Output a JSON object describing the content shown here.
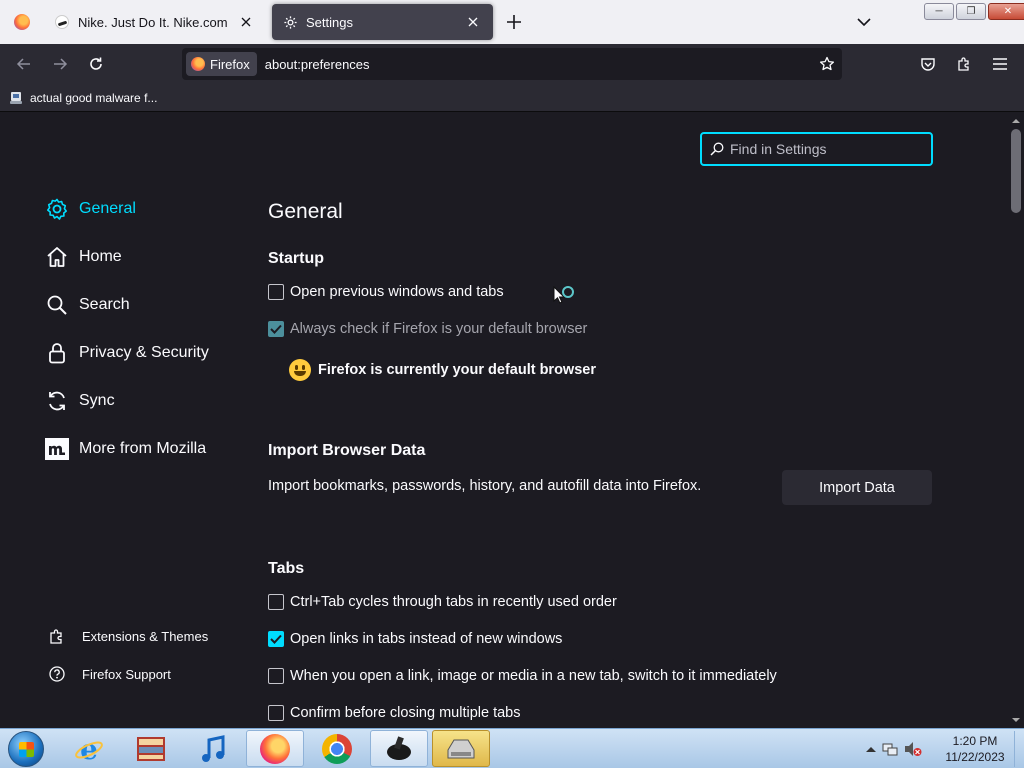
{
  "tabs": [
    {
      "title": "Nike. Just Do It. Nike.com",
      "icon": "nike-icon",
      "active": false
    },
    {
      "title": "Settings",
      "icon": "gear-icon",
      "active": true
    }
  ],
  "toolbar": {
    "identity_label": "Firefox",
    "url": "about:preferences"
  },
  "bookmarks": [
    {
      "label": "actual good malware f...",
      "icon": "bookmark-page-icon"
    }
  ],
  "search": {
    "placeholder": "Find in Settings"
  },
  "sidebar": {
    "categories": [
      {
        "label": "General",
        "icon": "gear-icon",
        "selected": true
      },
      {
        "label": "Home",
        "icon": "home-icon",
        "selected": false
      },
      {
        "label": "Search",
        "icon": "search-icon",
        "selected": false
      },
      {
        "label": "Privacy & Security",
        "icon": "lock-icon",
        "selected": false
      },
      {
        "label": "Sync",
        "icon": "sync-icon",
        "selected": false
      },
      {
        "label": "More from Mozilla",
        "icon": "mozilla-icon",
        "selected": false
      }
    ],
    "footer": [
      {
        "label": "Extensions & Themes",
        "icon": "puzzle-icon"
      },
      {
        "label": "Firefox Support",
        "icon": "help-icon"
      }
    ]
  },
  "main": {
    "title": "General",
    "startup": {
      "heading": "Startup",
      "open_previous": {
        "label": "Open previous windows and tabs",
        "checked": false
      },
      "check_default": {
        "label": "Always check if Firefox is your default browser",
        "checked": true
      },
      "default_note": "Firefox is currently your default browser"
    },
    "import": {
      "heading": "Import Browser Data",
      "description": "Import bookmarks, passwords, history, and autofill data into Firefox.",
      "button": "Import Data"
    },
    "tabs_section": {
      "heading": "Tabs",
      "options": [
        {
          "label": "Ctrl+Tab cycles through tabs in recently used order",
          "checked": false
        },
        {
          "label": "Open links in tabs instead of new windows",
          "checked": true
        },
        {
          "label": "When you open a link, image or media in a new tab, switch to it immediately",
          "checked": false
        },
        {
          "label": "Confirm before closing multiple tabs",
          "checked": false
        }
      ]
    }
  },
  "taskbar": {
    "time": "1:20 PM",
    "date": "11/22/2023",
    "apps": [
      "internet-explorer-icon",
      "media-center-icon",
      "itunes-icon",
      "firefox-icon",
      "chrome-icon",
      "app-icon",
      "hard-drive-icon"
    ]
  },
  "colors": {
    "accent": "#00ddff",
    "background": "#1c1b22",
    "toolbar": "#2b2a33"
  }
}
